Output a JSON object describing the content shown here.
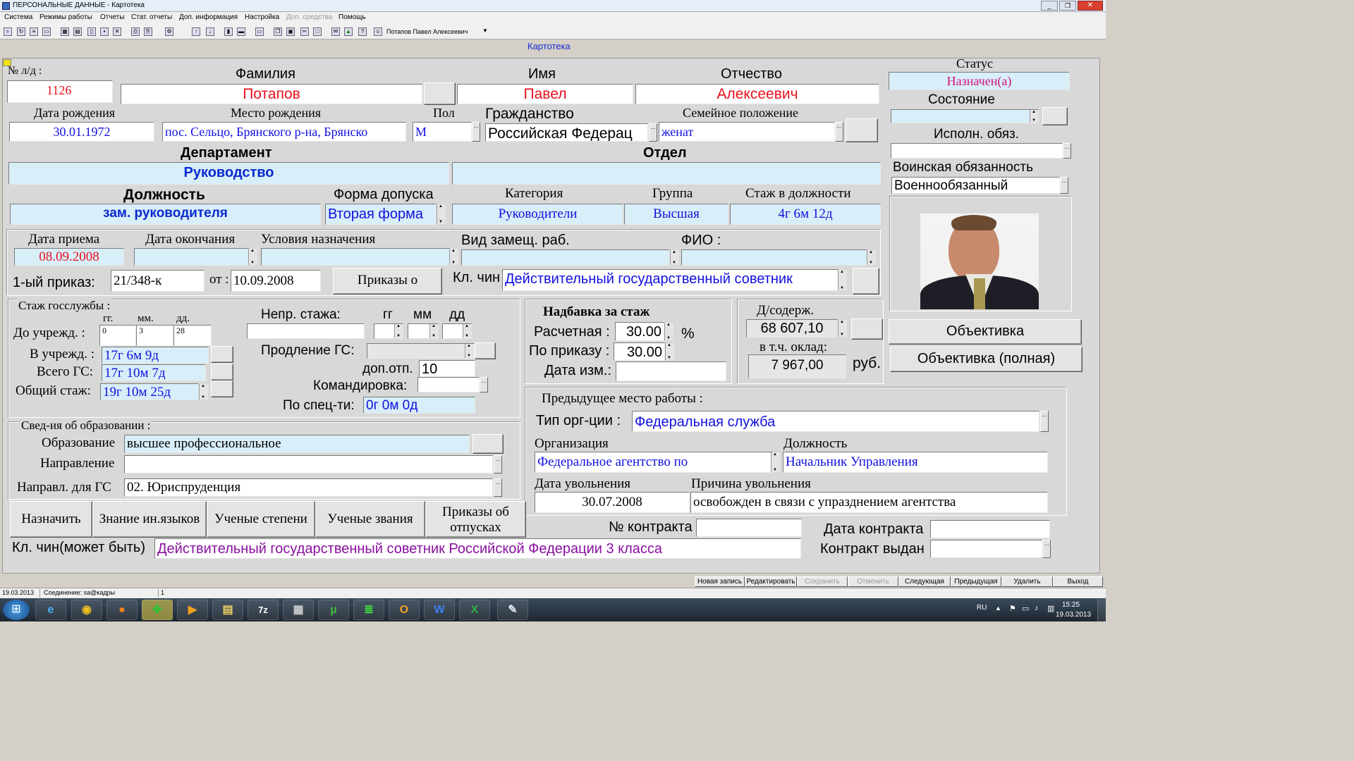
{
  "window": {
    "title": "ПЕРСОНАЛЬНЫЕ ДАННЫЕ - Картотека"
  },
  "menu": [
    "Система",
    "Режимы работы",
    "Отчеты",
    "Стат. отчеты",
    "Доп. информация",
    "Настройка",
    "Доп. средства",
    "Помощь"
  ],
  "toolbar": {
    "user": "Потапов Павел Алексеевич"
  },
  "form": {
    "title": "Картотека"
  },
  "person": {
    "ld_label": "№ л/д :",
    "ld": "1126",
    "surname_label": "Фамилия",
    "surname": "Потапов",
    "name_label": "Имя",
    "name": "Павел",
    "patronymic_label": "Отчество",
    "patronymic": "Алексеевич",
    "status_label": "Статус",
    "status": "Назначен(а)",
    "state_label": "Состояние",
    "duty_label": "Исполн. обяз.",
    "military_label": "Воинская обязанность",
    "military": "Военнообязанный",
    "birthdate_label": "Дата рождения",
    "birthdate": "30.01.1972",
    "birthplace_label": "Место рождения",
    "birthplace": "пос. Сельцо, Брянского р-на, Брянско",
    "sex_label": "Пол",
    "sex": "М",
    "citizenship_label": "Гражданство",
    "citizenship": "Российская Федерац",
    "family_label": "Семейное положение",
    "family": "женат"
  },
  "job": {
    "department_label": "Департамент",
    "department": "Руководство",
    "division_label": "Отдел",
    "position_label": "Должность",
    "position": "зам. руководителя",
    "clearance_label": "Форма допуска",
    "clearance": "Вторая форма",
    "category_label": "Категория",
    "category": "Руководители",
    "group_label": "Группа",
    "group": "Высшая",
    "tenure_label": "Стаж в должности",
    "tenure": "4г 6м 12д",
    "hire_label": "Дата приема",
    "hire": "08.09.2008",
    "end_label": "Дата окончания",
    "cond_label": "Условия назначения",
    "subst_label": "Вид замещ. раб.",
    "fio_label": "ФИО :",
    "order_label": "1-ый приказ:",
    "order": "21/348-к",
    "from_label": "от :",
    "from": "10.09.2008",
    "orders_btn": "Приказы о",
    "rank_label": "Кл. чин",
    "rank": "Действительный государственный советник"
  },
  "service": {
    "title": "Стаж госслужбы :",
    "gg": "гг.",
    "mm": "мм.",
    "dd": "дд.",
    "before_label": "До учрежд. :",
    "before_y": "0",
    "before_m": "3",
    "before_d": "28",
    "in_label": "В учрежд. :",
    "in": "17г 6м 9д",
    "total_gs_label": "Всего ГС:",
    "total_gs": "17г 10м 7д",
    "total_label": "Общий стаж:",
    "total": "19г 10м 25д",
    "unbroken_label": "Непр. стажа:",
    "gg2": "гг",
    "mm2": "мм",
    "dd2": "дд",
    "ext_label": "Продление ГС:",
    "vac_label": "доп.отп.",
    "vac": "10",
    "trip_label": "Командировка:",
    "spec_label": "По спец-ти:",
    "spec": "0г 0м 0д"
  },
  "bonus": {
    "title": "Надбавка за стаж",
    "calc_label": "Расчетная :",
    "calc": "30.00",
    "pct": "%",
    "order_label": "По приказу :",
    "order": "30.00",
    "date_label": "Дата изм.:"
  },
  "salary": {
    "label": "Д/содерж.",
    "value": "68 607,10",
    "incl_label": "в т.ч. оклад:",
    "incl": "7 967,00",
    "rub": "руб."
  },
  "buttons": {
    "objective": "Объективка",
    "objective_full": "Объективка (полная)"
  },
  "education": {
    "title": "Свед-ия об образовании :",
    "edu_label": "Образование",
    "edu": "высшее профессиональное",
    "dir_label": "Направление",
    "gsdir_label": "Направл. для ГС",
    "gsdir": "02. Юриспруденция"
  },
  "prev": {
    "title": "Предыдущее место работы :",
    "orgtype_label": "Тип орг-ции :",
    "orgtype": "Федеральная служба",
    "org_label": "Организация",
    "org": "Федеральное агентство по",
    "pos_label": "Должность",
    "pos": "Начальник Управления",
    "dismiss_label": "Дата увольнения",
    "dismiss": "30.07.2008",
    "reason_label": "Причина увольнения",
    "reason": "освобожден в связи с упразднением агентства"
  },
  "bottom": {
    "btn_assign": "Назначить",
    "btn_lang": "Знание ин.языков",
    "btn_degree": "Ученые степени",
    "btn_title": "Ученые звания",
    "btn_vac1": "Приказы об",
    "btn_vac2": "отпусках",
    "contract_label": "№ контракта",
    "contract_date_label": "Дата контракта",
    "contract_issued_label": "Контракт выдан",
    "rank_may_label": "Кл. чин(может быть)",
    "rank_may": "Действительный государственный советник Российской Федерации 3 класса"
  },
  "status": {
    "date": "19.03.2013",
    "conn": "Соединение: sa@кадры",
    "num": "1"
  },
  "actions": [
    "Новая запись",
    "Редактировать",
    "Сохранить",
    "Отменить",
    "Следующая",
    "Предыдущая",
    "Удалить",
    "Выход"
  ],
  "taskbar": {
    "lang": "RU",
    "time": "15:25",
    "date": "19.03.2013"
  }
}
